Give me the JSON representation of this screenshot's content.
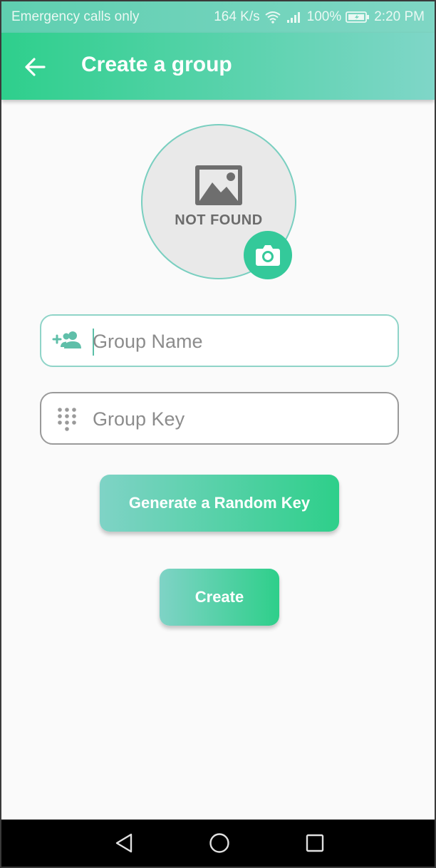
{
  "status_bar": {
    "carrier": "Emergency calls only",
    "speed": "164 K/s",
    "battery": "100%",
    "time": "2:20 PM",
    "icons": [
      "wifi-icon",
      "signal-icon",
      "battery-icon"
    ]
  },
  "app_bar": {
    "title": "Create a group",
    "back_icon": "arrow-left-icon"
  },
  "avatar": {
    "placeholder_text": "NOT FOUND",
    "icon": "image-icon",
    "camera_icon": "camera-icon"
  },
  "form": {
    "group_name": {
      "placeholder": "Group Name",
      "value": "",
      "icon": "add-group-icon"
    },
    "group_key": {
      "placeholder": "Group Key",
      "value": "",
      "icon": "dialpad-icon"
    }
  },
  "buttons": {
    "generate_label": "Generate a Random Key",
    "create_label": "Create"
  },
  "nav_bar": {
    "icons": [
      "back-triangle-icon",
      "home-circle-icon",
      "recents-square-icon"
    ]
  },
  "colors": {
    "accent": "#2ecf8c",
    "accent_light": "#7fd6c8",
    "status_bar": "#6fd3bb"
  }
}
